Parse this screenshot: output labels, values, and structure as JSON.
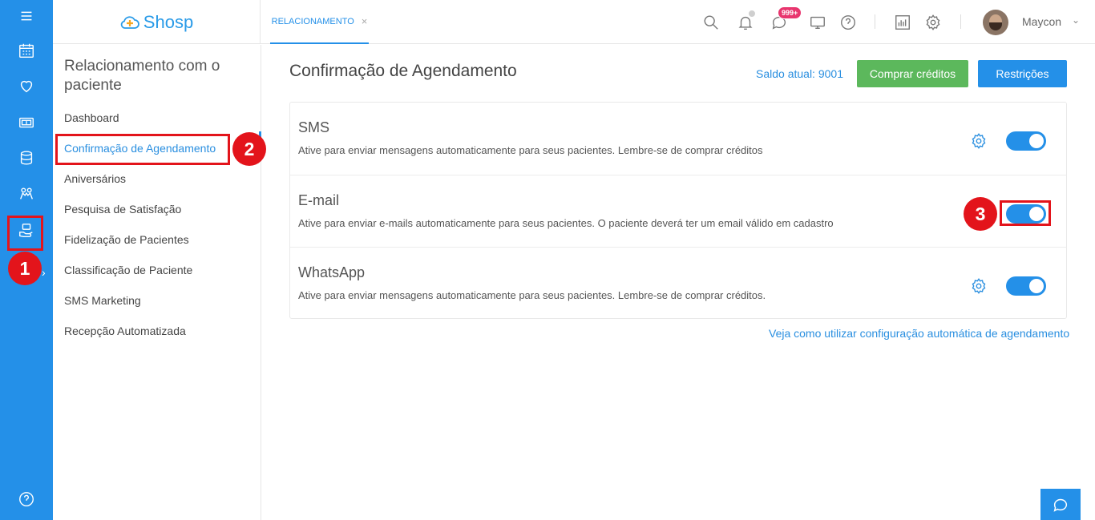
{
  "brand": {
    "name": "Shosp",
    "icon": "cloud-cross-logo"
  },
  "header": {
    "tab_label": "RELACIONAMENTO",
    "tab_close": "×",
    "icons": [
      "search-icon",
      "bell-icon",
      "chat-icon",
      "monitor-icon",
      "help-icon",
      "report-icon",
      "gear-icon"
    ],
    "messages_badge": "999+",
    "user_name": "Maycon",
    "user_chevron": "⌄"
  },
  "rail": {
    "icons": [
      "menu-icon",
      "calendar-icon",
      "heart-icon",
      "money-icon",
      "database-icon",
      "people-icon",
      "relationship-icon",
      "help-icon"
    ],
    "chevron": "›"
  },
  "sidebar": {
    "title": "Relacionamento com o paciente",
    "items": [
      {
        "label": "Dashboard",
        "active": false
      },
      {
        "label": "Confirmação de Agendamento",
        "active": true
      },
      {
        "label": "Aniversários",
        "active": false
      },
      {
        "label": "Pesquisa de Satisfação",
        "active": false
      },
      {
        "label": "Fidelização de Pacientes",
        "active": false
      },
      {
        "label": "Classificação de Paciente",
        "active": false
      },
      {
        "label": "SMS Marketing",
        "active": false
      },
      {
        "label": "Recepção Automatizada",
        "active": false
      }
    ]
  },
  "main": {
    "title": "Confirmação de Agendamento",
    "saldo": "Saldo atual: 9001",
    "buy_button": "Comprar créditos",
    "restrictions_button": "Restrições",
    "channels": [
      {
        "title": "SMS",
        "description": "Ative para enviar mensagens automaticamente para seus pacientes. Lembre-se de comprar créditos",
        "has_settings": true,
        "enabled": true
      },
      {
        "title": "E-mail",
        "description": "Ative para enviar e-mails automaticamente para seus pacientes. O paciente deverá ter um email válido em cadastro",
        "has_settings": false,
        "enabled": true
      },
      {
        "title": "WhatsApp",
        "description": "Ative para enviar mensagens automaticamente para seus pacientes. Lembre-se de comprar créditos.",
        "has_settings": true,
        "enabled": true
      }
    ],
    "help_link": "Veja como utilizar configuração automática de agendamento"
  },
  "annotations": [
    {
      "number": "1",
      "target": "rail-relationship"
    },
    {
      "number": "2",
      "target": "sidebar-item-confirmacao"
    },
    {
      "number": "3",
      "target": "email-toggle"
    }
  ],
  "colors": {
    "primary": "#2490e8",
    "success": "#5cb85c",
    "badge": "#e8356e",
    "annotation": "#e3141b"
  }
}
